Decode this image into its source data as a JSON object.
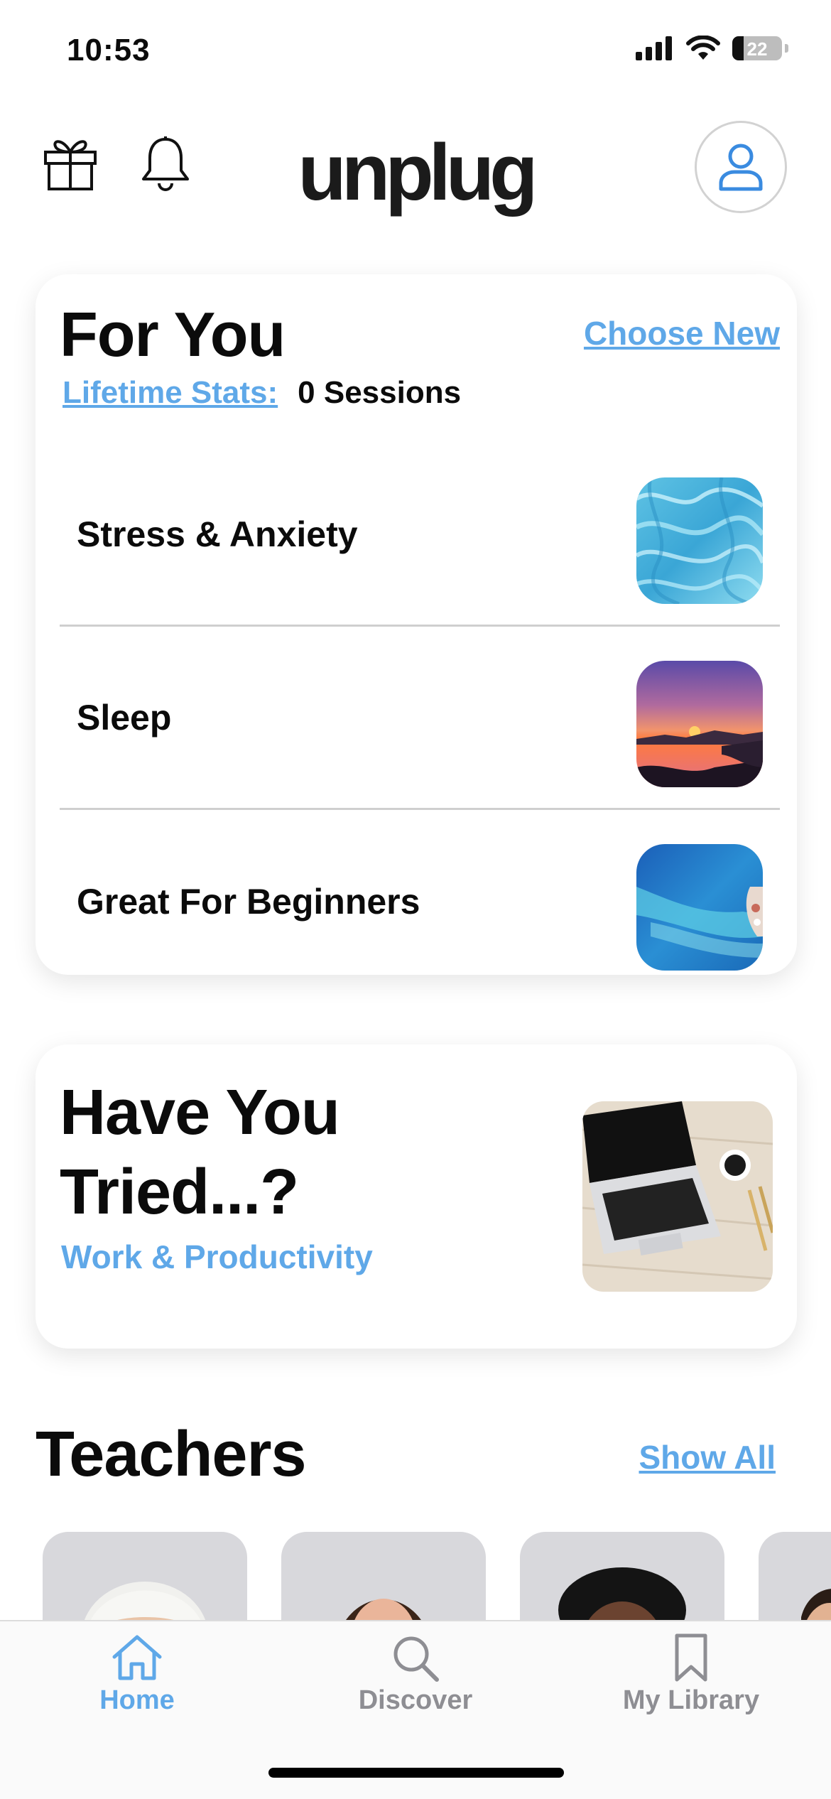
{
  "status_bar": {
    "time": "10:53",
    "battery": "22"
  },
  "header": {
    "logo": "unplug"
  },
  "for_you": {
    "title": "For You",
    "choose_new": "Choose New",
    "stats_label": "Lifetime Stats:",
    "stats_value": "0 Sessions",
    "items": [
      {
        "label": "Stress & Anxiety",
        "image": "water-ripples-image"
      },
      {
        "label": "Sleep",
        "image": "sunset-lake-image"
      },
      {
        "label": "Great For Beginners",
        "image": "ocean-aerial-image"
      }
    ]
  },
  "have_you_tried": {
    "title": "Have You Tried...?",
    "subtitle": "Work & Productivity",
    "image": "laptop-desk-image"
  },
  "teachers": {
    "title": "Teachers",
    "show_all": "Show All"
  },
  "tab_bar": {
    "tabs": [
      {
        "label": "Home",
        "icon": "home-icon",
        "active": true
      },
      {
        "label": "Discover",
        "icon": "search-icon",
        "active": false
      },
      {
        "label": "My Library",
        "icon": "bookmark-icon",
        "active": false
      }
    ]
  },
  "colors": {
    "accent": "#5fa8e8",
    "text": "#0b0b0b",
    "inactive": "#8e8e93"
  }
}
